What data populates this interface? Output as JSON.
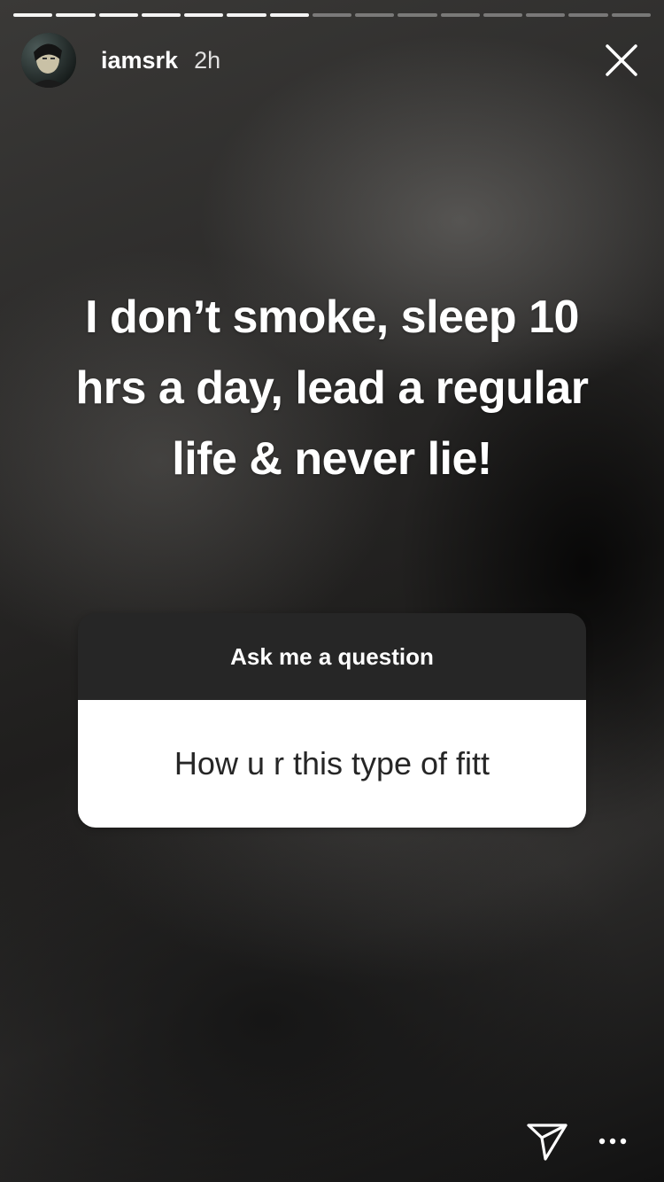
{
  "progress": {
    "segments_total": 15,
    "segments_viewed": 7
  },
  "header": {
    "username": "iamsrk",
    "timestamp": "2h",
    "close_icon": "close-icon"
  },
  "story": {
    "caption_lines": [
      "I don’t smoke, sleep 10",
      "hrs a day, lead a regular",
      "life & never lie!"
    ]
  },
  "question_sticker": {
    "prompt": "Ask me a question",
    "answer": "How u r this type of fitt",
    "header_color": "#262626",
    "answer_bg_color": "#ffffff"
  },
  "footer": {
    "share_icon": "send-icon",
    "more_icon": "more-options-icon"
  }
}
